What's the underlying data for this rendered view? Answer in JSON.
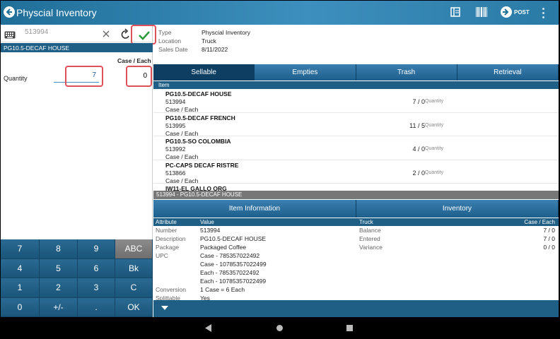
{
  "header": {
    "title": "Physcial Inventory",
    "post_label": "POST"
  },
  "search": {
    "value": "513994"
  },
  "current_item": "PG10.5-DECAF HOUSE",
  "entry": {
    "case_each_header": "Case / Each",
    "quantity_label": "Quantity",
    "case_value": "7",
    "each_value": "0"
  },
  "keypad": {
    "keys": [
      "7",
      "8",
      "9",
      "ABC",
      "4",
      "5",
      "6",
      "Bk",
      "1",
      "2",
      "3",
      "C",
      "0",
      "+/-",
      ".",
      "OK"
    ]
  },
  "info": {
    "type_label": "Type",
    "type_value": "Physcial Inventory",
    "location_label": "Location",
    "location_value": "Truck",
    "date_label": "Sales Date",
    "date_value": "8/11/2022"
  },
  "tabs": [
    "Sellable",
    "Empties",
    "Trash",
    "Retrieval"
  ],
  "list": {
    "header": "Item",
    "items": [
      {
        "name": "PG10.5-DECAF HOUSE",
        "code": "513994",
        "unit": "Case / Each",
        "qty": "7 / 0",
        "qty_label": "Quantity"
      },
      {
        "name": "PG10.5-DECAF FRENCH",
        "code": "513995",
        "unit": "Case / Each",
        "qty": "11 / 5",
        "qty_label": "Quantity"
      },
      {
        "name": "PG10.5-SO COLOMBIA",
        "code": "513992",
        "unit": "Case / Each",
        "qty": "4 / 0",
        "qty_label": "Quantity"
      },
      {
        "name": "PC-CAPS DECAF RISTRE",
        "code": "513866",
        "unit": "Case / Each",
        "qty": "2 / 0",
        "qty_label": "Quantity"
      },
      {
        "name": "IW11-EL GALLO ORG",
        "code": "",
        "unit": "",
        "qty": "",
        "qty_label": ""
      }
    ]
  },
  "detail": {
    "bar": "513994 - PG10.5-DECAF HOUSE",
    "tab_item": "Item Information",
    "tab_inventory": "Inventory",
    "attr_header": "Attribute",
    "value_header": "Value",
    "truck_header": "Truck",
    "case_each_header": "Case / Each",
    "attributes": [
      {
        "a": "Number",
        "v": "513994"
      },
      {
        "a": "Description",
        "v": "PG10.5-DECAF HOUSE"
      },
      {
        "a": "Package",
        "v": "Packaged Coffee"
      },
      {
        "a": "UPC",
        "v": "Case - 785357022492"
      },
      {
        "a": "",
        "v": "Case - 10785357022499"
      },
      {
        "a": "",
        "v": "Each - 785357022492"
      },
      {
        "a": "",
        "v": "Each - 10785357022499"
      },
      {
        "a": "Conversion",
        "v": "1 Case = 6 Each"
      },
      {
        "a": "Splittable",
        "v": "Yes"
      }
    ],
    "inventory": [
      {
        "a": "Balance",
        "v": "7 / 0"
      },
      {
        "a": "Entered",
        "v": "7 / 0"
      },
      {
        "a": "Variance",
        "v": "0 / 0"
      }
    ]
  }
}
